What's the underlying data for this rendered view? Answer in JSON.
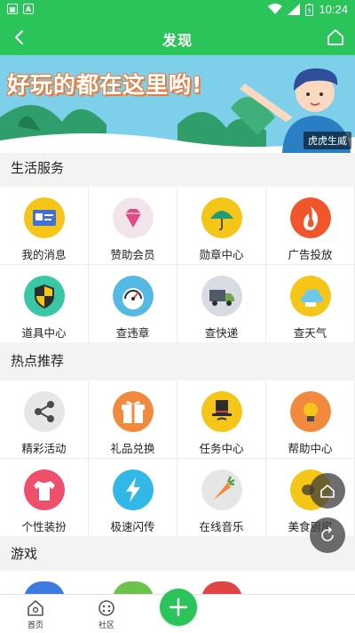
{
  "status_bar": {
    "time": "10:24"
  },
  "app_bar": {
    "title": "发现"
  },
  "banner": {
    "headline": "好玩的都在这里哟!",
    "badge": "虎虎生威"
  },
  "sections": [
    {
      "title": "生活服务"
    },
    {
      "title": "热点推荐"
    },
    {
      "title": "游戏"
    }
  ],
  "life_services": [
    {
      "label": "我的消息",
      "icon": "id-card-icon",
      "color": "#f5c617"
    },
    {
      "label": "赞助会员",
      "icon": "diamond-icon",
      "color": "#f1e4ea"
    },
    {
      "label": "勋章中心",
      "icon": "umbrella-icon",
      "color": "#f5c617"
    },
    {
      "label": "广告投放",
      "icon": "flame-icon",
      "color": "#f0562a"
    },
    {
      "label": "道具中心",
      "icon": "shield-icon",
      "color": "#3ac7a5"
    },
    {
      "label": "查违章",
      "icon": "speedometer-icon",
      "color": "#54b9e3"
    },
    {
      "label": "查快递",
      "icon": "truck-icon",
      "color": "#d8dbe1"
    },
    {
      "label": "查天气",
      "icon": "cloud-icon",
      "color": "#f5c617"
    }
  ],
  "hot_picks": [
    {
      "label": "精彩活动",
      "icon": "share-icon",
      "color": "#e6e6e6"
    },
    {
      "label": "礼品兑换",
      "icon": "gift-icon",
      "color": "#f28a3e"
    },
    {
      "label": "任务中心",
      "icon": "top-hat-icon",
      "color": "#f5c617"
    },
    {
      "label": "帮助中心",
      "icon": "lightbulb-icon",
      "color": "#f28a3e"
    },
    {
      "label": "个性装扮",
      "icon": "tshirt-icon",
      "color": "#ef4f6a"
    },
    {
      "label": "极速闪传",
      "icon": "lightning-icon",
      "color": "#31b8e6"
    },
    {
      "label": "在线音乐",
      "icon": "carrot-icon",
      "color": "#e6e6e6"
    },
    {
      "label": "美食厨房",
      "icon": "lemon-icon",
      "color": "#f5c617"
    }
  ],
  "games_peek": [
    {
      "icon": "game-1-icon",
      "color": "#3d7be0"
    },
    {
      "icon": "game-2-icon",
      "color": "#6cc24a"
    },
    {
      "icon": "game-3-icon",
      "color": "#e04444"
    }
  ],
  "bottom_nav": {
    "home_label": "首页",
    "community_label": "社区"
  },
  "colors": {
    "brand": "#2bc45a"
  }
}
